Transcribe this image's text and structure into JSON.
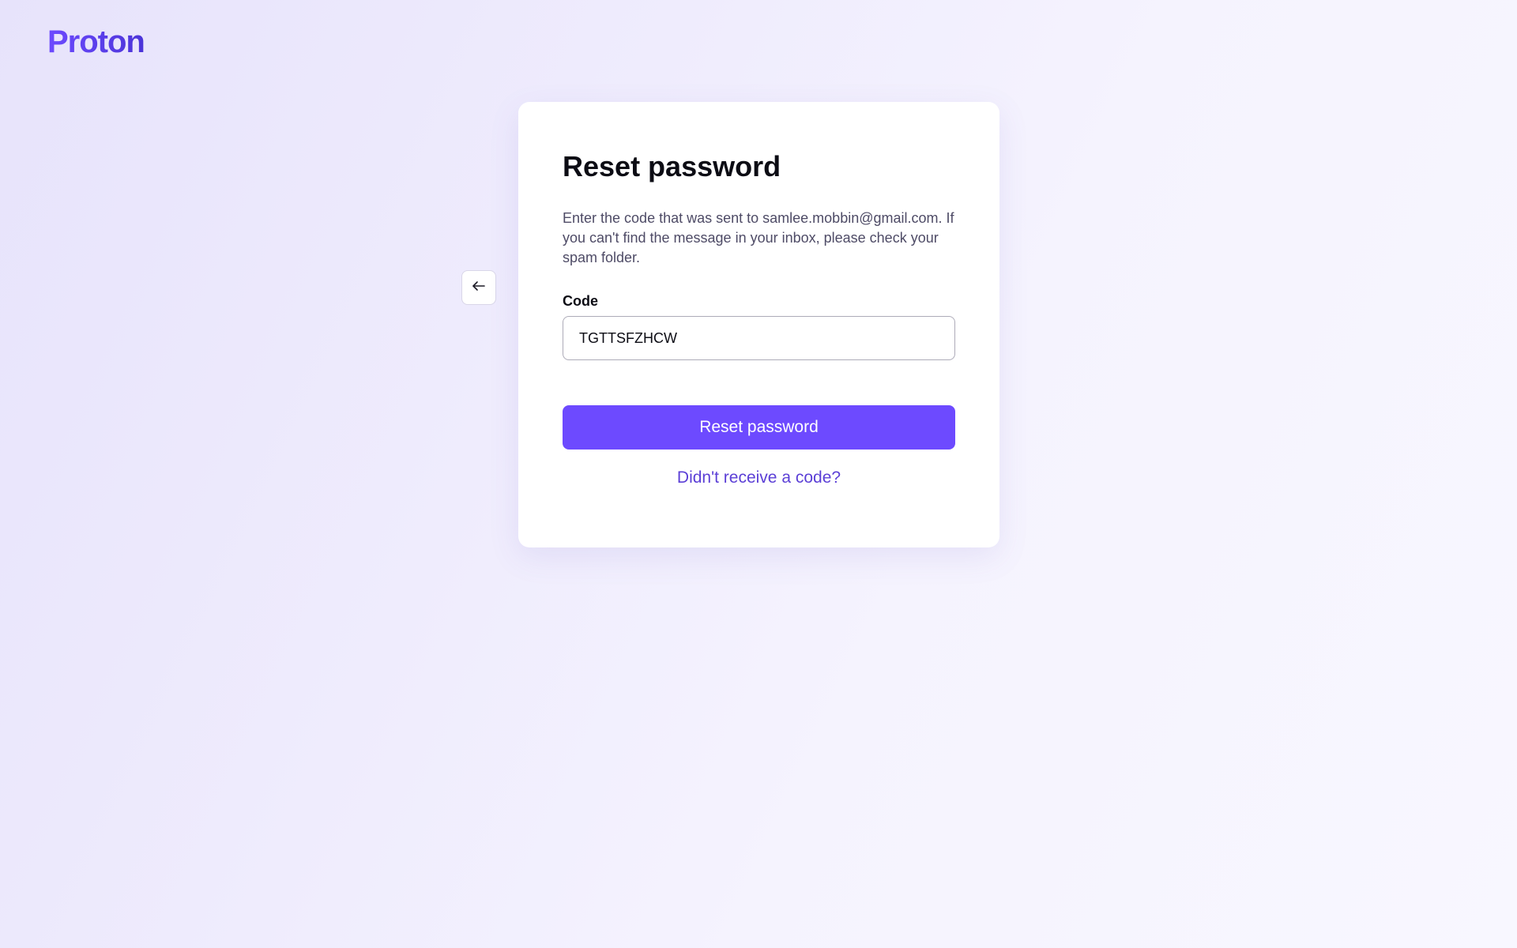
{
  "brand": {
    "logo_text": "Proton",
    "accent_color": "#6d4aff"
  },
  "nav": {
    "back_icon": "arrow-left-icon"
  },
  "card": {
    "title": "Reset password",
    "description": "Enter the code that was sent to samlee.mobbin@gmail.com. If you can't find the message in your inbox, please check your spam folder.",
    "code_label": "Code",
    "code_value": "TGTTSFZHCW",
    "submit_label": "Reset password",
    "resend_link": "Didn't receive a code?"
  }
}
